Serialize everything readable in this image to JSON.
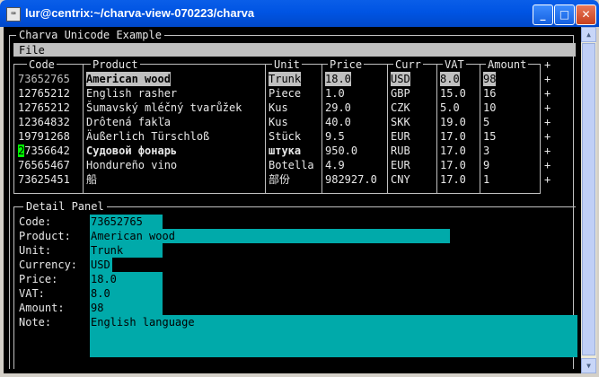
{
  "window": {
    "title": "lur@centrix:~/charva-view-070223/charva"
  },
  "app": {
    "frame_title": "Charva Unicode Example",
    "menu": [
      "File"
    ]
  },
  "table": {
    "columns": [
      "Code",
      "Product",
      "Unit",
      "Price",
      "Curr",
      "VAT",
      "Amount"
    ],
    "rows": [
      [
        "73652765",
        "American wood",
        "Trunk",
        "18.0",
        "USD",
        "8.0",
        "98"
      ],
      [
        "12765212",
        "English rasher",
        "Piece",
        "1.0",
        "GBP",
        "15.0",
        "16"
      ],
      [
        "12765212",
        "Šumavský mléčný tvarůžek",
        "Kus",
        "29.0",
        "CZK",
        "5.0",
        "10"
      ],
      [
        "12364832",
        "Drôtená fakľa",
        "Kus",
        "40.0",
        "SKK",
        "19.0",
        "5"
      ],
      [
        "19791268",
        "Äußerlich Türschloß",
        "Stück",
        "9.5",
        "EUR",
        "17.0",
        "15"
      ],
      [
        "27356642",
        "Судовой фонарь",
        "штука",
        "950.0",
        "RUB",
        "17.0",
        "3"
      ],
      [
        "76565467",
        "Hondureño vino",
        "Botella",
        "4.9",
        "EUR",
        "17.0",
        "9"
      ],
      [
        "73625451",
        "船",
        "部份",
        "982927.0",
        "CNY",
        "17.0",
        "1"
      ]
    ],
    "selected_row": 0,
    "row_markers": [
      "+",
      "+",
      "+",
      "+",
      "+",
      "+",
      "+",
      "+",
      "+"
    ]
  },
  "detail": {
    "title": "Detail Panel",
    "fields": [
      {
        "label": "Code:",
        "value": "73652765"
      },
      {
        "label": "Product:",
        "value": "American wood"
      },
      {
        "label": "Unit:",
        "value": "Trunk"
      },
      {
        "label": "Currency:",
        "value": "USD"
      },
      {
        "label": "Price:",
        "value": "18.0"
      },
      {
        "label": "VAT:",
        "value": "8.0"
      },
      {
        "label": "Amount:",
        "value": "98"
      },
      {
        "label": "Note:",
        "value": "English language"
      }
    ]
  },
  "colors": {
    "field_bg": "#00aaaa",
    "cursor": "#00ff00",
    "titlebar": "#0054e3"
  }
}
